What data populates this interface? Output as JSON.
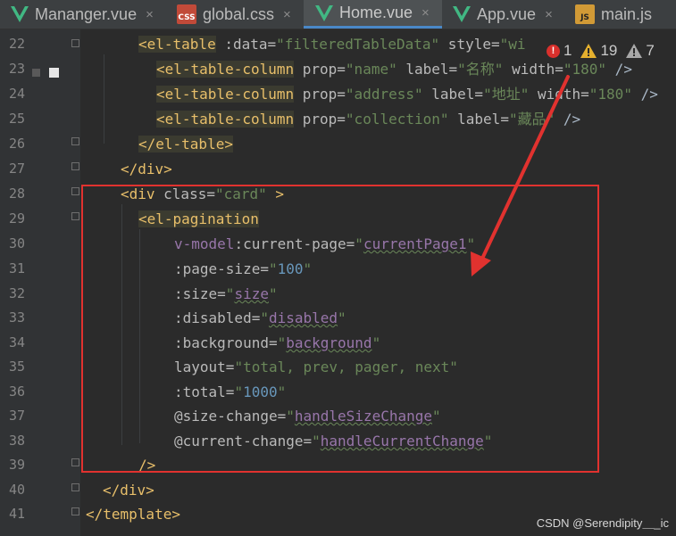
{
  "tabs": [
    {
      "label": "Mananger.vue",
      "icon": "vue-icon",
      "active": false
    },
    {
      "label": "global.css",
      "icon": "css-icon",
      "active": false
    },
    {
      "label": "Home.vue",
      "icon": "vue-icon",
      "active": true
    },
    {
      "label": "App.vue",
      "icon": "vue-icon",
      "active": false
    },
    {
      "label": "main.js",
      "icon": "js-icon",
      "active": false
    }
  ],
  "file_icon_text": {
    "css": "CSS",
    "js": "JS"
  },
  "tab_close_glyph": "×",
  "inspections": {
    "errors": "1",
    "warnings": "19",
    "weak_warnings": "7"
  },
  "line_numbers": [
    "22",
    "23",
    "24",
    "25",
    "26",
    "27",
    "28",
    "29",
    "30",
    "31",
    "32",
    "33",
    "34",
    "35",
    "36",
    "37",
    "38",
    "39",
    "40",
    "41"
  ],
  "code": {
    "l22": {
      "tag": "<el-table",
      "a1": " :data=",
      "v1": "\"filteredTableData\"",
      "a2": " style=",
      "v2": "\"wi"
    },
    "l23": {
      "tag": "<el-table-column",
      "a1": " prop=",
      "v1": "\"name\"",
      "a2": " label=",
      "v2": "\"名称\"",
      "a3": " width=",
      "v3": "\"180\"",
      "end": " />"
    },
    "l24": {
      "tag": "<el-table-column",
      "a1": " prop=",
      "v1": "\"address\"",
      "a2": " label=",
      "v2": "\"地址\"",
      "a3": " width=",
      "v3": "\"180\"",
      "end": " />"
    },
    "l25": {
      "tag": "<el-table-column",
      "a1": " prop=",
      "v1": "\"collection\"",
      "a2": " label=",
      "v2": "\"藏品\"",
      "end": " />"
    },
    "l26": {
      "tag": "</el-table>"
    },
    "l27": {
      "tag": "</div>"
    },
    "l28": {
      "tag": "<div",
      "a1": " class=",
      "v1": "\"card\"",
      "end": " >"
    },
    "l29": {
      "tag": "<el-pagination"
    },
    "l30": {
      "a1": "v-model",
      "a1b": ":current-page=",
      "q1": "\"",
      "ref": "currentPage1",
      "q2": "\""
    },
    "l31": {
      "a1": ":page-size=",
      "q1": "\"",
      "num": "100",
      "q2": "\""
    },
    "l32": {
      "a1": ":size=",
      "q1": "\"",
      "ref": "size",
      "q2": "\""
    },
    "l33": {
      "a1": ":disabled=",
      "q1": "\"",
      "ref": "disabled",
      "q2": "\""
    },
    "l34": {
      "a1": ":background=",
      "q1": "\"",
      "ref": "background",
      "q2": "\""
    },
    "l35": {
      "a1": "layout=",
      "v1": "\"total, prev, pager, next\""
    },
    "l36": {
      "a1": ":total=",
      "q1": "\"",
      "num": "1000",
      "q2": "\""
    },
    "l37": {
      "a1": "@size-change=",
      "q1": "\"",
      "ref": "handleSizeChange",
      "q2": "\""
    },
    "l38": {
      "a1": "@current-change=",
      "q1": "\"",
      "ref": "handleCurrentChange",
      "q2": "\""
    },
    "l39": {
      "tag": "/>"
    },
    "l40": {
      "tag": "</div>"
    },
    "l41": {
      "tag": "</template>"
    }
  },
  "watermark": "CSDN @Serendipity＿_ic",
  "colors": {
    "annotation_red": "#e1322f",
    "tag": "#e8bf6a",
    "string": "#6a8759",
    "number": "#6897bb",
    "accent_tab": "#4a88c7"
  }
}
